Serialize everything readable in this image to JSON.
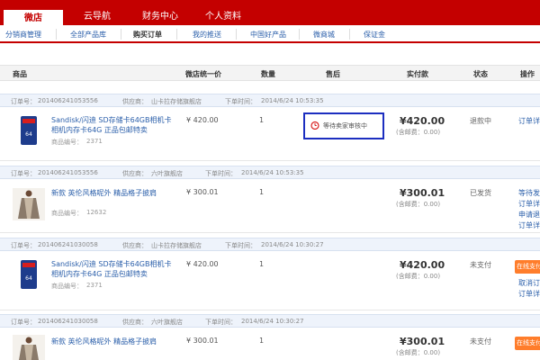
{
  "topnav": {
    "tabs": [
      "微店",
      "云导航",
      "财务中心",
      "个人资料"
    ]
  },
  "subnav": {
    "items": [
      "分销商管理",
      "全部产品库",
      "购买订单",
      "我的推送",
      "中国好产品",
      "微商城",
      "保证金"
    ]
  },
  "table_header": {
    "product": "商品",
    "unit_price": "微店统一价",
    "quantity": "数量",
    "after_sale": "售后",
    "paid": "实付款",
    "status": "状态",
    "operation": "操作"
  },
  "orders": [
    {
      "order_label": "订单号：",
      "order_no": "201406241053556",
      "supplier_label": "供应商：",
      "supplier": "山卡拉存储旗舰店",
      "time_label": "下单时间：",
      "time": "2014/6/24 10:53:35",
      "product_name": "Sandisk/闪迪 SD存储卡64GB相机卡相机内存卡64G 正品包邮特卖",
      "product_code_label": "商品编号：",
      "product_code": "2371",
      "unit_price": "¥ 420.00",
      "quantity": "1",
      "after_sale": "等待卖家审核中",
      "paid": "¥420.00",
      "paid_note": "(含邮费：0.00)",
      "status": "退款中",
      "operation": "订单详"
    },
    {
      "order_label": "订单号：",
      "order_no": "201406241053556",
      "supplier_label": "供应商：",
      "supplier": "六叶旗舰店",
      "time_label": "下单时间：",
      "time": "2014/6/24 10:53:35",
      "product_name": "新款 英伦风格呢外 精品格子披肩",
      "product_code_label": "商品编号：",
      "product_code": "12632",
      "unit_price": "¥ 300.01",
      "quantity": "1",
      "paid": "¥300.01",
      "paid_note": "(含邮费：0.00)",
      "status": "已发货",
      "operations": [
        "等待发",
        "订单详",
        "申请退",
        "订单详"
      ]
    },
    {
      "order_label": "订单号：",
      "order_no": "201406241030058",
      "supplier_label": "供应商：",
      "supplier": "山卡拉存储旗舰店",
      "time_label": "下单时间：",
      "time": "2014/6/24 10:30:27",
      "product_name": "Sandisk/闪迪 SD存储卡64GB相机卡相机内存卡64G 正品包邮特卖",
      "product_code_label": "商品编号：",
      "product_code": "2371",
      "unit_price": "¥ 420.00",
      "quantity": "1",
      "paid": "¥420.00",
      "paid_note": "(含邮费：0.00)",
      "status": "未支付",
      "button": "在线支付",
      "operations": [
        "取消订",
        "订单详"
      ]
    },
    {
      "order_label": "订单号：",
      "order_no": "201406241030058",
      "supplier_label": "供应商：",
      "supplier": "六叶旗舰店",
      "time_label": "下单时间：",
      "time": "2014/6/24 10:30:27",
      "product_name": "新款 英伦风格呢外 精品格子披肩",
      "unit_price": "¥ 300.01",
      "quantity": "1",
      "paid": "¥300.01",
      "paid_note": "(含邮费：0.00)",
      "status": "未支付",
      "button": "在线支付"
    }
  ],
  "colors": {
    "brand_red": "#c40000",
    "link_blue": "#2b5faa",
    "highlight_box": "#1c2ec0",
    "pay_button": "#ff7d2b"
  }
}
